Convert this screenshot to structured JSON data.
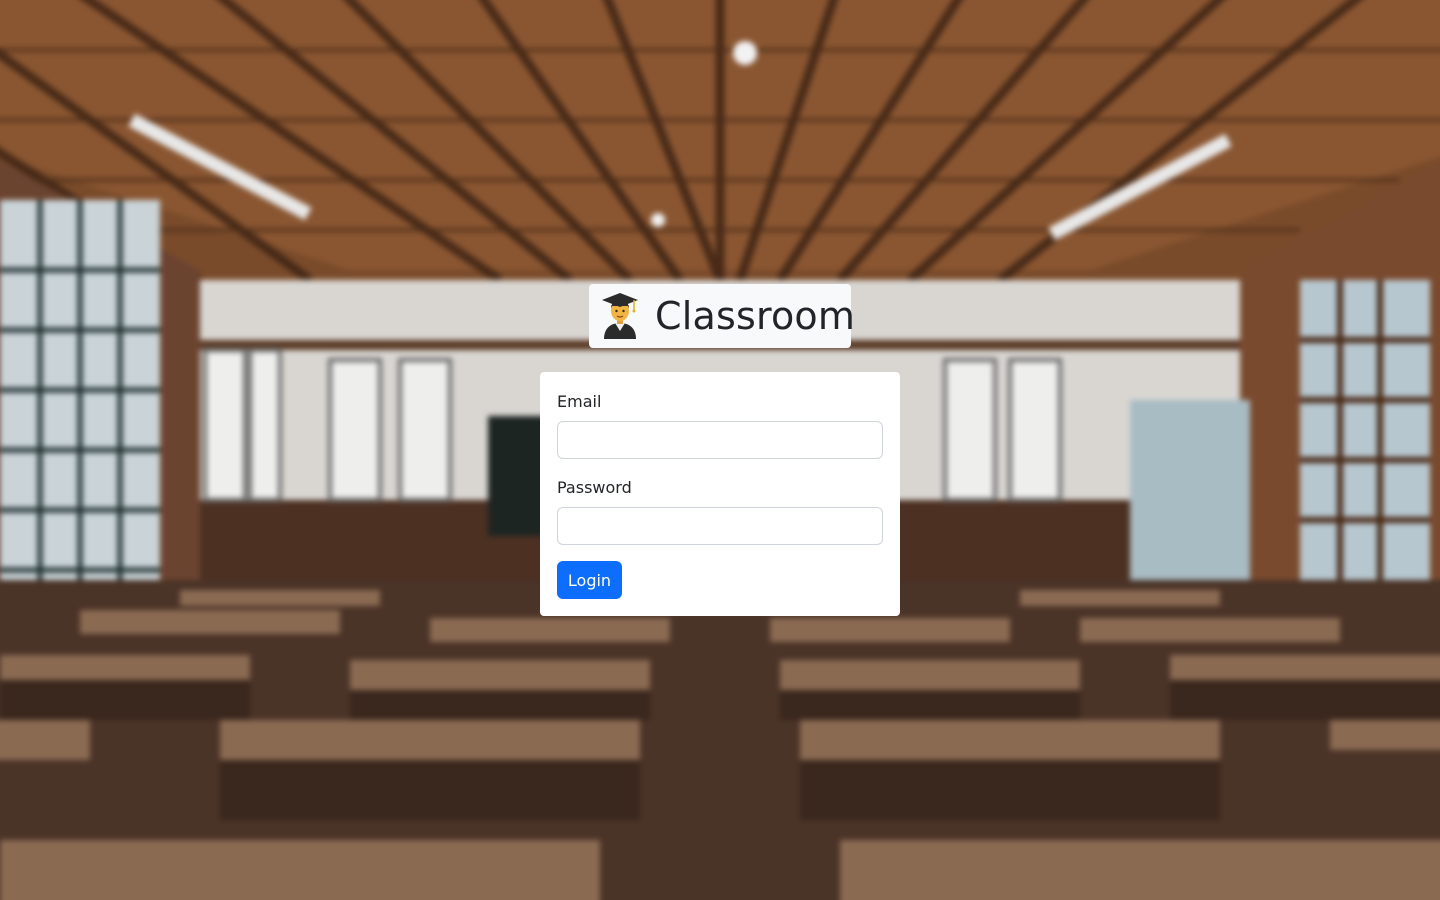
{
  "app": {
    "title": "Classroom",
    "icon": "student-graduate-icon"
  },
  "login_form": {
    "email_label": "Email",
    "email_value": "",
    "password_label": "Password",
    "password_value": "",
    "submit_label": "Login"
  },
  "colors": {
    "primary_button": "#0d6efd",
    "card_background": "#ffffff",
    "brand_background": "#f8f9fa",
    "text": "#212529"
  }
}
